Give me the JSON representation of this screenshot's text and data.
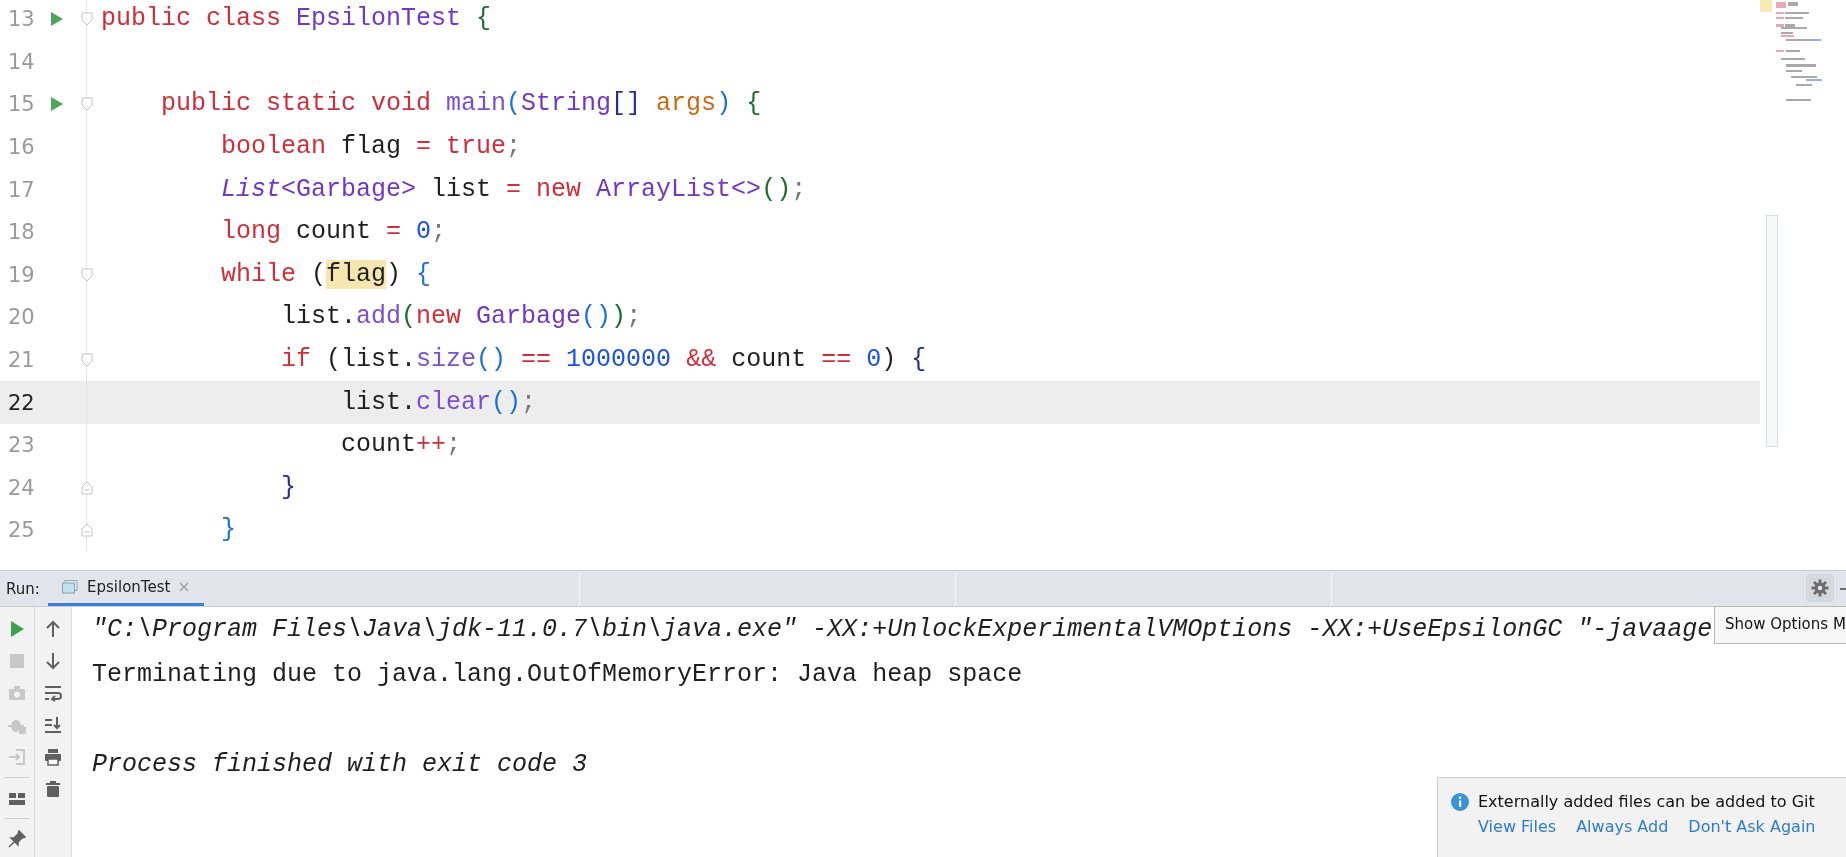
{
  "editor": {
    "lines": [
      {
        "number": "13",
        "run": true,
        "kind": "fold-start",
        "current": false,
        "tokens": [
          {
            "text": "public class ",
            "kind": "kw"
          },
          {
            "text": "EpsilonTest ",
            "kind": "type"
          },
          {
            "text": "{",
            "kind": "b1"
          }
        ],
        "children": [
          {
            "number": "14",
            "run": false,
            "current": false
          },
          {
            "number": "15",
            "run": true,
            "kind": "fold-start",
            "current": false,
            "tokens": [
              {
                "text": "public static void ",
                "kind": "kw"
              },
              {
                "text": "main",
                "kind": "method"
              },
              {
                "text": "(",
                "kind": "b2"
              },
              {
                "text": "String",
                "kind": "type"
              },
              {
                "text": "[] ",
                "kind": "b3"
              },
              {
                "text": "args",
                "kind": "param"
              },
              {
                "text": ") ",
                "kind": "b2"
              },
              {
                "text": "{",
                "kind": "b1"
              }
            ],
            "children": [
              {
                "number": "16",
                "run": false,
                "current": false,
                "tokens": [
                  {
                    "text": "boolean",
                    "kind": "kw"
                  },
                  {
                    "text": " flag ",
                    "kind": "plain"
                  },
                  {
                    "text": "= ",
                    "kind": "kw"
                  },
                  {
                    "text": "true",
                    "kind": "kw"
                  },
                  {
                    "text": ";",
                    "kind": "punct"
                  }
                ]
              },
              {
                "number": "17",
                "run": false,
                "current": false,
                "tokens": [
                  {
                    "text": "List",
                    "kind": "itype"
                  },
                  {
                    "text": "<Garbage>",
                    "kind": "type"
                  },
                  {
                    "text": " list ",
                    "kind": "plain"
                  },
                  {
                    "text": "= ",
                    "kind": "kw"
                  },
                  {
                    "text": "new ",
                    "kind": "kw"
                  },
                  {
                    "text": "ArrayList<>",
                    "kind": "type"
                  },
                  {
                    "text": "()",
                    "kind": "b1"
                  },
                  {
                    "text": ";",
                    "kind": "punct"
                  }
                ]
              },
              {
                "number": "18",
                "run": false,
                "current": false,
                "tokens": [
                  {
                    "text": "long",
                    "kind": "kw"
                  },
                  {
                    "text": " count ",
                    "kind": "plain"
                  },
                  {
                    "text": "= ",
                    "kind": "kw"
                  },
                  {
                    "text": "0",
                    "kind": "num"
                  },
                  {
                    "text": ";",
                    "kind": "punct"
                  }
                ]
              },
              {
                "number": "19",
                "run": false,
                "kind": "fold-start",
                "current": false,
                "tokens": [
                  {
                    "text": "while",
                    "kind": "kw"
                  },
                  {
                    "text": " (",
                    "kind": "plain"
                  },
                  {
                    "text": "flag",
                    "kind": "hl"
                  },
                  {
                    "text": ") ",
                    "kind": "plain"
                  },
                  {
                    "text": "{",
                    "kind": "b2"
                  }
                ],
                "children": [
                  {
                    "number": "20",
                    "run": false,
                    "current": false,
                    "tokens": [
                      {
                        "text": "list.",
                        "kind": "plain"
                      },
                      {
                        "text": "add",
                        "kind": "method"
                      },
                      {
                        "text": "(",
                        "kind": "b1"
                      },
                      {
                        "text": "new ",
                        "kind": "kw"
                      },
                      {
                        "text": "Garbage",
                        "kind": "type"
                      },
                      {
                        "text": "()",
                        "kind": "b2"
                      },
                      {
                        "text": ")",
                        "kind": "b1"
                      },
                      {
                        "text": ";",
                        "kind": "punct"
                      }
                    ]
                  },
                  {
                    "number": "21",
                    "run": false,
                    "kind": "fold-start",
                    "current": false,
                    "tokens": [
                      {
                        "text": "if",
                        "kind": "kw"
                      },
                      {
                        "text": " (list.",
                        "kind": "plain"
                      },
                      {
                        "text": "size",
                        "kind": "method"
                      },
                      {
                        "text": "() ",
                        "kind": "b2"
                      },
                      {
                        "text": "== ",
                        "kind": "kw"
                      },
                      {
                        "text": "1000000 ",
                        "kind": "num"
                      },
                      {
                        "text": "&&",
                        "kind": "kw"
                      },
                      {
                        "text": " count ",
                        "kind": "plain"
                      },
                      {
                        "text": "== ",
                        "kind": "kw"
                      },
                      {
                        "text": "0",
                        "kind": "num"
                      },
                      {
                        "text": ") ",
                        "kind": "plain"
                      },
                      {
                        "text": "{",
                        "kind": "b3"
                      }
                    ],
                    "children": [
                      {
                        "number": "22",
                        "run": false,
                        "current": true,
                        "tokens": [
                          {
                            "text": "list.",
                            "kind": "plain"
                          },
                          {
                            "text": "clear",
                            "kind": "method"
                          },
                          {
                            "text": "()",
                            "kind": "b2"
                          },
                          {
                            "text": ";",
                            "kind": "punct"
                          }
                        ]
                      },
                      {
                        "number": "23",
                        "run": false,
                        "current": false,
                        "tokens": [
                          {
                            "text": "count",
                            "kind": "plain"
                          },
                          {
                            "text": "++",
                            "kind": "kw"
                          },
                          {
                            "text": ";",
                            "kind": "punct"
                          }
                        ]
                      }
                    ]
                  },
                  {
                    "number": "24",
                    "run": false,
                    "kind": "fold-end",
                    "current": false,
                    "tokens": [
                      {
                        "text": "}",
                        "kind": "b3"
                      }
                    ]
                  }
                ]
              },
              {
                "number": "25",
                "run": false,
                "kind": "fold-end",
                "current": false,
                "tokens": [
                  {
                    "text": "}",
                    "kind": "b2"
                  }
                ]
              }
            ]
          }
        ]
      }
    ]
  },
  "run_panel": {
    "label": "Run:",
    "tabs": [
      {
        "label": "EpsilonTest",
        "selected": true
      }
    ],
    "tools_left": [
      {
        "kind": "run",
        "disabled": false
      },
      {
        "kind": "stop",
        "disabled": true
      },
      {
        "kind": "camera",
        "disabled": true
      },
      {
        "kind": "bug",
        "disabled": true
      },
      {
        "kind": "exit",
        "disabled": true
      },
      {
        "kind": "layout",
        "disabled": false
      },
      {
        "kind": "pin",
        "disabled": false
      }
    ],
    "tools_right": [
      {
        "kind": "up",
        "disabled": false
      },
      {
        "kind": "down",
        "disabled": false
      },
      {
        "kind": "wrap",
        "disabled": false
      },
      {
        "kind": "scroll-end",
        "disabled": false
      },
      {
        "kind": "print",
        "disabled": false
      },
      {
        "kind": "trash",
        "disabled": false
      }
    ],
    "console": [
      {
        "kind": "command",
        "text": "\"C:\\Program Files\\Java\\jdk-11.0.7\\bin\\java.exe\" -XX:+UnlockExperimentalVMOptions -XX:+UseEpsilonGC \"-javaage"
      },
      {
        "kind": "output",
        "text": "Terminating due to java.lang.OutOfMemoryError: Java heap space"
      },
      {
        "kind": "exit",
        "text": "Process finished with exit code 3"
      }
    ],
    "tooltip": "Show Options M"
  },
  "notification": {
    "message": "Externally added files can be added to Git",
    "actions": [
      "View Files",
      "Always Add",
      "Don't Ask Again"
    ]
  }
}
